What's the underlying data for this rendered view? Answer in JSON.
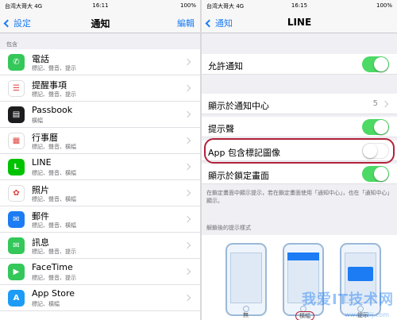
{
  "left": {
    "status": {
      "carrier": "台湾大哥大 4G",
      "time": "16:11",
      "battery": "100%"
    },
    "nav": {
      "back": "設定",
      "title": "通知",
      "edit": "編輯"
    },
    "section": "包含",
    "apps": [
      {
        "name": "電話",
        "sub": "標記、聲音、提示",
        "icon": "phone-icon",
        "color": "#34c759",
        "glyph": "✆"
      },
      {
        "name": "提醒事項",
        "sub": "標記、聲音、提示",
        "icon": "reminders-icon",
        "color": "#ffffff",
        "glyph": "☰"
      },
      {
        "name": "Passbook",
        "sub": "橫幅",
        "icon": "passbook-icon",
        "color": "#1c1c1e",
        "glyph": "▤"
      },
      {
        "name": "行事曆",
        "sub": "標記、聲音、橫幅",
        "icon": "calendar-icon",
        "color": "#ffffff",
        "glyph": "▦"
      },
      {
        "name": "LINE",
        "sub": "標記、聲音、橫幅",
        "icon": "line-icon",
        "color": "#00c300",
        "glyph": "L"
      },
      {
        "name": "照片",
        "sub": "標記、聲音、橫幅",
        "icon": "photos-icon",
        "color": "#ffffff",
        "glyph": "✿"
      },
      {
        "name": "郵件",
        "sub": "標記、聲音、橫幅",
        "icon": "mail-icon",
        "color": "#1c7cf4",
        "glyph": "✉"
      },
      {
        "name": "訊息",
        "sub": "標記、聲音、提示",
        "icon": "messages-icon",
        "color": "#34c759",
        "glyph": "✉"
      },
      {
        "name": "FaceTime",
        "sub": "標記、聲音、提示",
        "icon": "facetime-icon",
        "color": "#34c759",
        "glyph": "▶"
      },
      {
        "name": "App Store",
        "sub": "標記、橫幅",
        "icon": "appstore-icon",
        "color": "#1c9cf6",
        "glyph": "A"
      }
    ]
  },
  "right": {
    "status": {
      "carrier": "台湾大哥大 4G",
      "time": "16:15",
      "battery": "100%"
    },
    "nav": {
      "back": "通知",
      "title": "LINE"
    },
    "allow": {
      "label": "允許通知",
      "on": true
    },
    "show_center": {
      "label": "顯示於通知中心",
      "value": "5"
    },
    "sound": {
      "label": "提示聲",
      "on": true
    },
    "badge": {
      "label": "App 包含標記圖像",
      "on": false
    },
    "lock": {
      "label": "顯示於鎖定畫面",
      "on": true
    },
    "note": "在鎖定畫面中顯示提示，若在鎖定畫面使用「通知中心」，也在「通知中心」顯示。",
    "alert_header": "解鎖後的提示樣式",
    "alert_styles": [
      "無",
      "橫幅",
      "提示"
    ],
    "accent": "#4cd964",
    "highlight_color": "#b3223a"
  },
  "watermark": {
    "text": "我爱IT技术网",
    "url": "www.52ij.com"
  }
}
